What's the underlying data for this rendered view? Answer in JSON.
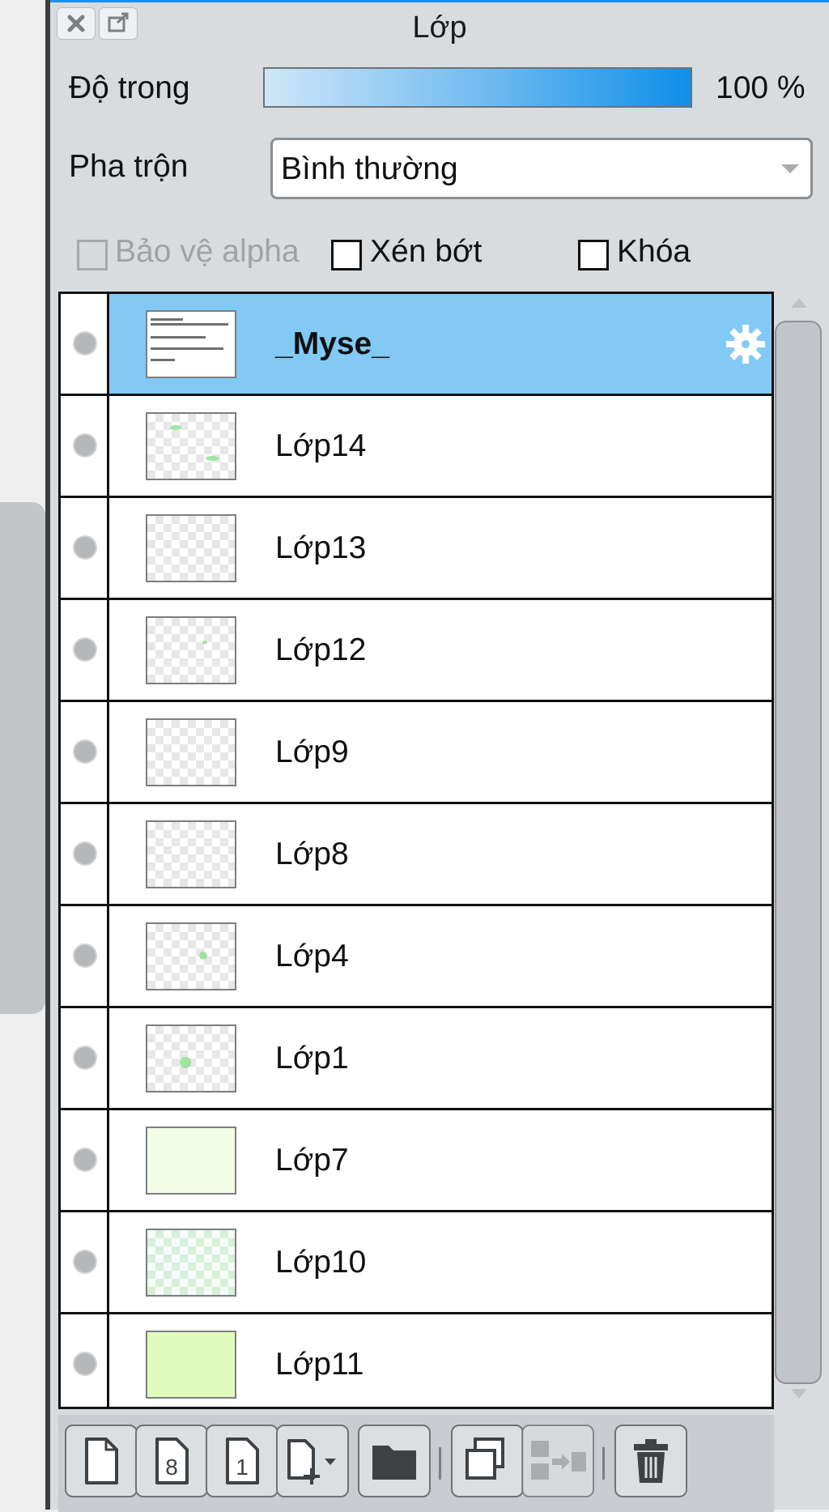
{
  "panel": {
    "title": "Lớp",
    "opacity_label": "Độ trong",
    "opacity_value": "100 %",
    "opacity_fraction": 1.0,
    "blend_label": "Pha trộn",
    "blend_value": "Bình thường",
    "checkboxes": {
      "protect_alpha": "Bảo vệ alpha",
      "clipping": "Xén bớt",
      "lock": "Khóa"
    }
  },
  "layers": [
    {
      "name": "_Myse_",
      "selected": true,
      "thumb": "text"
    },
    {
      "name": "Lớp14",
      "thumb": "transparent"
    },
    {
      "name": "Lớp13",
      "thumb": "transparent"
    },
    {
      "name": "Lớp12",
      "thumb": "transparent"
    },
    {
      "name": "Lớp9",
      "thumb": "transparent"
    },
    {
      "name": "Lớp8",
      "thumb": "transparent"
    },
    {
      "name": "Lớp4",
      "thumb": "transparent"
    },
    {
      "name": "Lớp1",
      "thumb": "transparent"
    },
    {
      "name": "Lớp7",
      "thumb": "light-green-fill"
    },
    {
      "name": "Lớp10",
      "thumb": "mint-pattern"
    },
    {
      "name": "Lớp11",
      "thumb": "green-fill"
    }
  ],
  "toolbar": {
    "icons": [
      "new-layer-icon",
      "new-8bit-layer-icon",
      "new-1bit-layer-icon",
      "add-special-layer-icon",
      "new-folder-icon",
      "duplicate-layer-icon",
      "merge-down-icon",
      "delete-layer-icon"
    ],
    "badge_8": "8",
    "badge_1": "1"
  },
  "colors": {
    "accent": "#1f8ee8",
    "selected_row": "#82caf5",
    "panel_bg": "#d9dcdf"
  }
}
